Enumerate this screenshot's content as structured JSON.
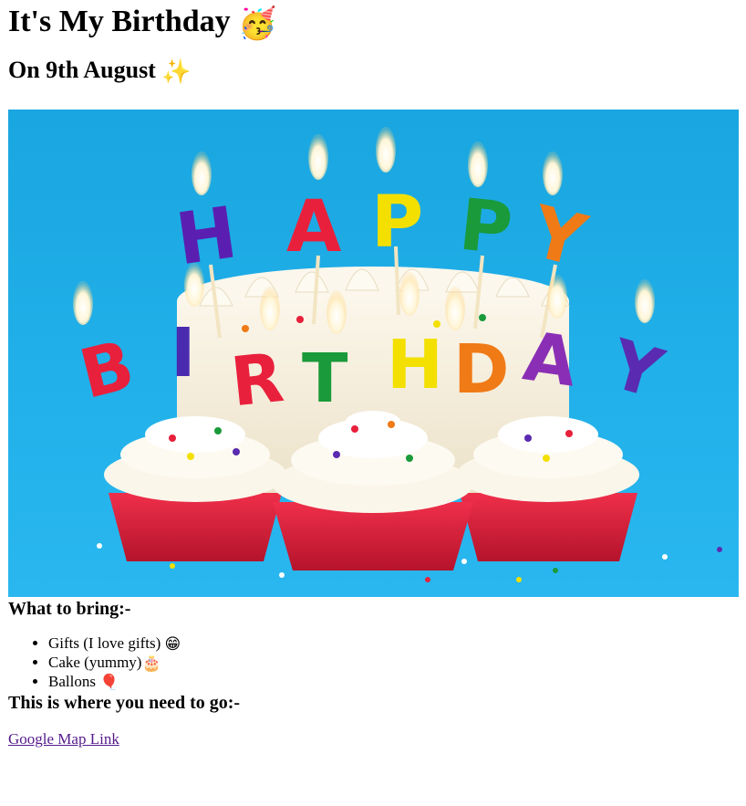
{
  "header": {
    "title": "It's My Birthday",
    "title_emoji": "🥳",
    "date": "On 9th August",
    "date_emoji": "✨"
  },
  "hero": {
    "description_icon": "birthday-cupcakes-candles-image",
    "candles_top": [
      "H",
      "A",
      "P",
      "P",
      "Y"
    ],
    "candles_bottom": [
      "B",
      "I",
      "R",
      "T",
      "H",
      "D",
      "A",
      "Y"
    ],
    "background_color": "#20aee8"
  },
  "bring": {
    "heading": "What to bring:-",
    "items": [
      {
        "text": "Gifts (I love gifts)",
        "emoji": "😁"
      },
      {
        "text": "Cake (yummy)",
        "emoji": "🎂"
      },
      {
        "text": "Ballons",
        "emoji": "🎈"
      }
    ]
  },
  "location": {
    "heading": "This is where you need to go:-",
    "link_text": "Google Map Link"
  },
  "colors": {
    "link_visited": "#551a8b",
    "sky": "#20aee8",
    "cup_red": "#e0203a",
    "frosting": "#f7f1e3"
  }
}
